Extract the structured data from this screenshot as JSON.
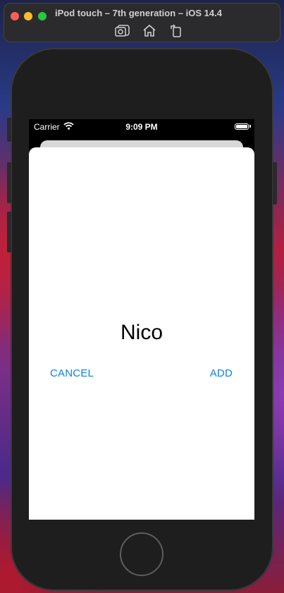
{
  "window": {
    "title": "iPod touch – 7th generation – iOS 14.4",
    "toolbar_icons": [
      "screenshot-icon",
      "home-icon",
      "rotate-icon"
    ]
  },
  "status_bar": {
    "carrier": "Carrier",
    "time": "9:09 PM"
  },
  "dialog": {
    "name": "Nico",
    "cancel_label": "CANCEL",
    "add_label": "ADD",
    "accent_color": "#0a84d8"
  }
}
